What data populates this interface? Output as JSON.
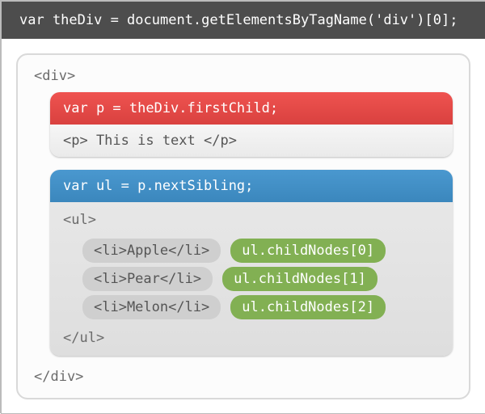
{
  "topCode": "var theDiv = document.getElementsByTagName('div')[0];",
  "div": {
    "open": "<div>",
    "close": "</div>",
    "pBox": {
      "header": "var p = theDiv.firstChild;",
      "body": "<p> This is text </p>"
    },
    "ulBox": {
      "header": "var ul = p.nextSibling;",
      "open": "<ul>",
      "close": "</ul>",
      "items": [
        {
          "li": "<li>Apple</li>",
          "note": "ul.childNodes[0]"
        },
        {
          "li": "<li>Pear</li>",
          "note": "ul.childNodes[1]"
        },
        {
          "li": "<li>Melon</li>",
          "note": "ul.childNodes[2]"
        }
      ]
    }
  }
}
